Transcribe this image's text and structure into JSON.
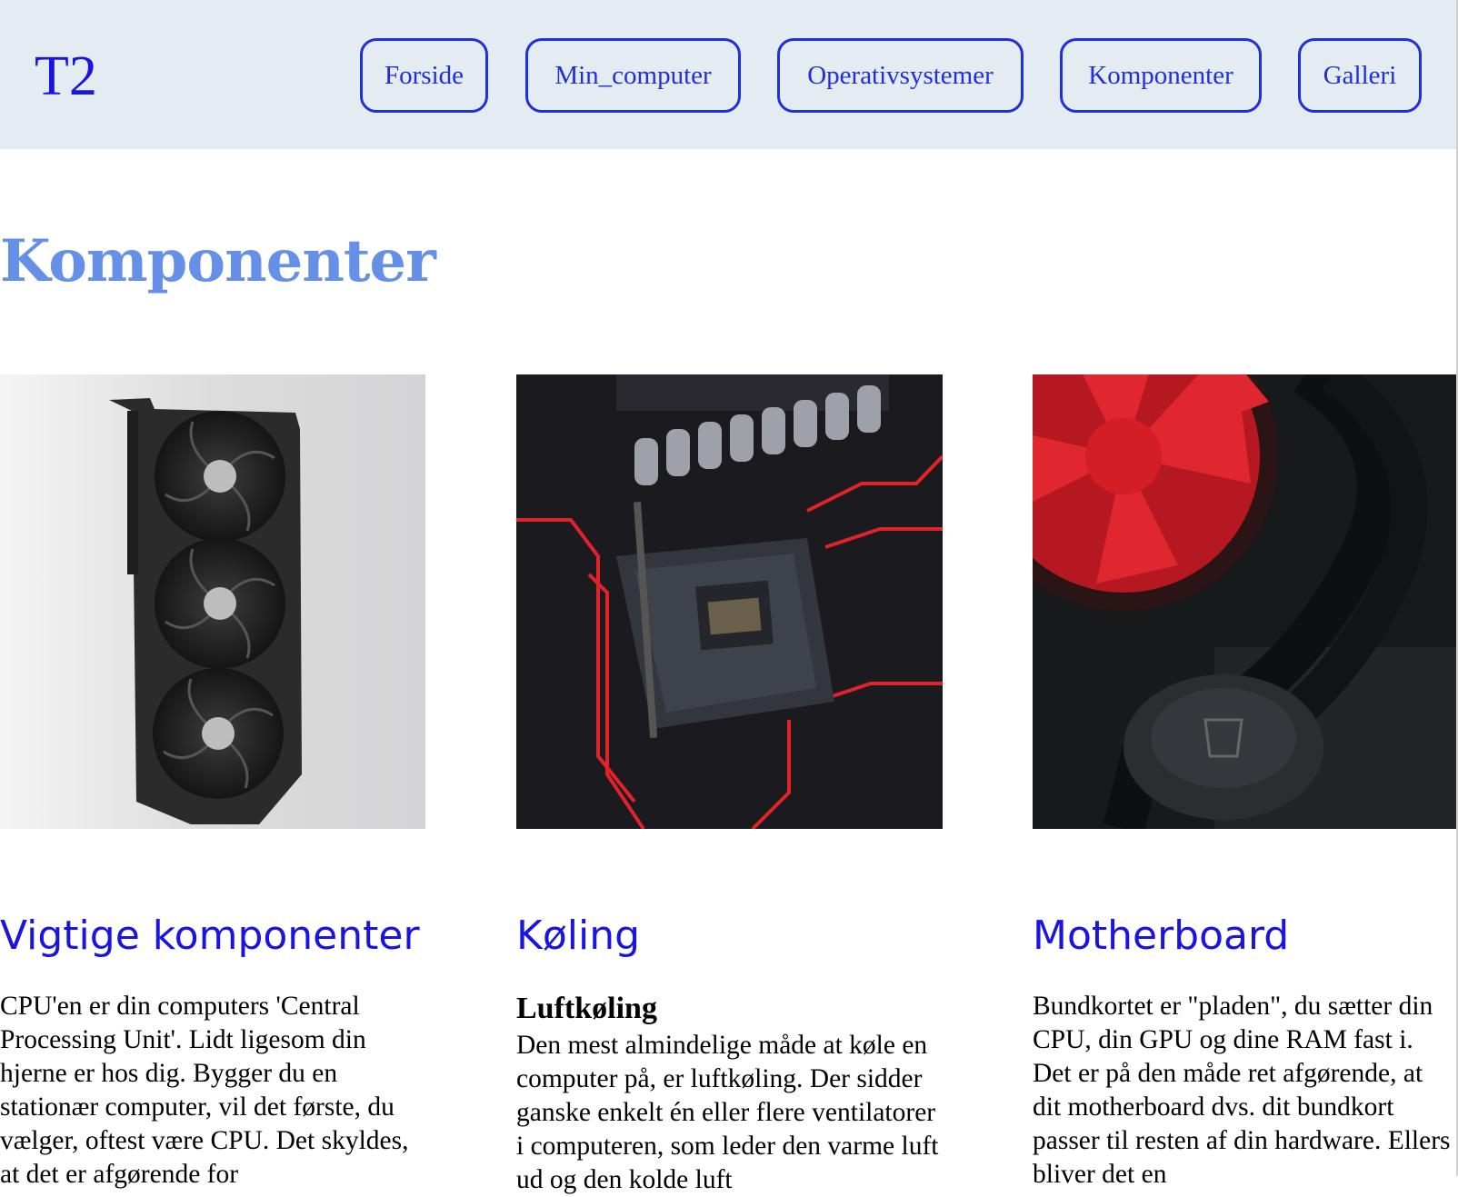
{
  "header": {
    "logo": "T2",
    "nav": [
      "Forside",
      "Min_computer",
      "Operativsystemer",
      "Komponenter",
      "Galleri"
    ]
  },
  "page": {
    "title": "Komponenter"
  },
  "columns": [
    {
      "image_label": "graphics-card-photo",
      "heading": "Vigtige komponenter",
      "text": "CPU'en er din computers 'Central Processing Unit'. Lidt ligesom din hjerne er hos dig. Bygger du en stationær computer, vil det første, du vælger, oftest være CPU. Det skyldes, at det er afgørende for"
    },
    {
      "image_label": "cpu-socket-photo",
      "heading": "Køling",
      "subheading": "Luftkøling",
      "text": "Den mest almindelige måde at køle en computer på, er luftkøling. Der sidder ganske enkelt én eller flere ventilatorer i computeren, som leder den varme luft ud og den kolde luft"
    },
    {
      "image_label": "cooling-fan-photo",
      "heading": "Motherboard",
      "text": "Bundkortet er \"pladen\", du sætter din CPU, din GPU og dine RAM fast i. Det er på den måde ret afgørende, at dit motherboard dvs. dit bundkort passer til resten af din hardware. Ellers bliver det en"
    }
  ],
  "colors": {
    "link_blue": "#1f2fe0",
    "title_blue": "#6690e8",
    "header_bg": "#e4ebf1"
  }
}
